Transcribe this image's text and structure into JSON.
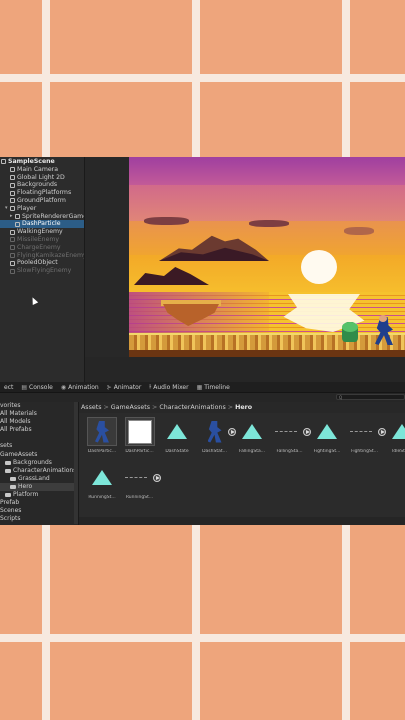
{
  "hierarchy": {
    "scene": "SampleScene",
    "items": [
      {
        "label": "Main Camera",
        "state": "normal",
        "indent": 1
      },
      {
        "label": "Global Light 2D",
        "state": "normal",
        "indent": 1
      },
      {
        "label": "Backgrounds",
        "state": "normal",
        "indent": 1
      },
      {
        "label": "FloatingPlatforms",
        "state": "normal",
        "indent": 1
      },
      {
        "label": "GroundPlatform",
        "state": "normal",
        "indent": 1
      },
      {
        "label": "Player",
        "state": "normal",
        "indent": 1
      },
      {
        "label": "SpriteRendererGameObject",
        "state": "normal",
        "indent": 2
      },
      {
        "label": "DashParticle",
        "state": "selected",
        "indent": 2
      },
      {
        "label": "WalkingEnemy",
        "state": "normal",
        "indent": 1
      },
      {
        "label": "MissileEnemy",
        "state": "disabled",
        "indent": 1
      },
      {
        "label": "ChargeEnemy",
        "state": "disabled",
        "indent": 1
      },
      {
        "label": "FlyingKamikazeEnemy",
        "state": "disabled",
        "indent": 1
      },
      {
        "label": "PooledObject",
        "state": "normal",
        "indent": 1
      },
      {
        "label": "SlowFlyingEnemy",
        "state": "disabled",
        "indent": 1
      }
    ]
  },
  "tabs": [
    {
      "label": "ect",
      "icon": ""
    },
    {
      "label": "Console",
      "icon": "▤"
    },
    {
      "label": "Animation",
      "icon": "◉"
    },
    {
      "label": "Animator",
      "icon": "⊱"
    },
    {
      "label": "Audio Mixer",
      "icon": "⫲"
    },
    {
      "label": "Timeline",
      "icon": "▦"
    }
  ],
  "search": {
    "placeholder": "Q"
  },
  "project": {
    "tree": [
      {
        "label": "vorites",
        "indent": 0,
        "folder": false
      },
      {
        "label": "All Materials",
        "indent": 0,
        "folder": false
      },
      {
        "label": "All Models",
        "indent": 0,
        "folder": false
      },
      {
        "label": "All Prefabs",
        "indent": 0,
        "folder": false
      },
      {
        "label": "",
        "indent": 0,
        "folder": false
      },
      {
        "label": "sets",
        "indent": 0,
        "folder": false
      },
      {
        "label": "GameAssets",
        "indent": 0,
        "folder": false
      },
      {
        "label": "Backgrounds",
        "indent": 1,
        "folder": true
      },
      {
        "label": "CharacterAnimations",
        "indent": 1,
        "folder": true
      },
      {
        "label": "GrassLand",
        "indent": 2,
        "folder": true
      },
      {
        "label": "Hero",
        "indent": 2,
        "folder": true,
        "selected": true
      },
      {
        "label": "Platform",
        "indent": 1,
        "folder": true
      },
      {
        "label": "Prefab",
        "indent": 0,
        "folder": false
      },
      {
        "label": "Scenes",
        "indent": 0,
        "folder": false
      },
      {
        "label": "Scripts",
        "indent": 0,
        "folder": false
      }
    ],
    "breadcrumb": [
      "Assets",
      "GameAssets",
      "CharacterAnimations",
      "Hero"
    ],
    "assets": [
      {
        "label": "DashPartic...",
        "kind": "hero-framed"
      },
      {
        "label": "DashPartic...",
        "kind": "white"
      },
      {
        "label": "DashState",
        "kind": "triangle"
      },
      {
        "label": "DashStat...",
        "kind": "hero-play"
      },
      {
        "label": "FallingSta...",
        "kind": "triangle"
      },
      {
        "label": "FallingSta...",
        "kind": "dash-play"
      },
      {
        "label": "FightingSt...",
        "kind": "triangle"
      },
      {
        "label": "FightingSt...",
        "kind": "dash-play"
      },
      {
        "label": "IdleSta...",
        "kind": "triangle"
      },
      {
        "label": "RunningSt...",
        "kind": "triangle"
      },
      {
        "label": "RunningSt...",
        "kind": "dash-play"
      }
    ]
  }
}
